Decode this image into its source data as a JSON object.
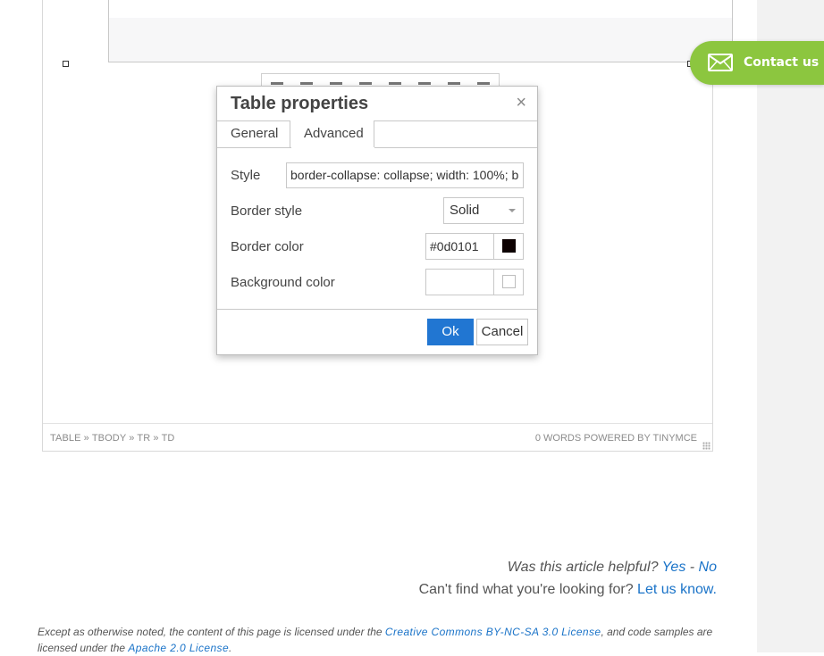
{
  "dialog": {
    "title": "Table properties",
    "close_glyph": "×",
    "tabs": [
      {
        "label": "General"
      },
      {
        "label": "Advanced"
      }
    ],
    "fields": {
      "style_label": "Style",
      "style_value": "border-collapse: collapse; width: 100%; b",
      "border_style_label": "Border style",
      "border_style_value": "Solid",
      "border_color_label": "Border color",
      "border_color_value": "#0d0101",
      "background_color_label": "Background color",
      "background_color_value": ""
    },
    "buttons": {
      "ok": "Ok",
      "cancel": "Cancel"
    }
  },
  "statusbar": {
    "path": "TABLE » TBODY » TR » TD",
    "word_count": "0 WORDS POWERED BY TINYMCE"
  },
  "contact": {
    "label": "Contact us",
    "icon": "envelope-icon"
  },
  "feedback": {
    "question": "Was this article helpful?",
    "yes": "Yes",
    "separator": "-",
    "no": "No",
    "cant_find": "Can't find what you're looking for?",
    "let_us_know": "Let us know."
  },
  "license": {
    "part1": "Except as otherwise noted, the content of this page is licensed under the ",
    "cc_link": "Creative Commons BY-NC-SA 3.0 License",
    "part2": ", and code samples are licensed under the ",
    "apache_link": "Apache 2.0 License",
    "part3": "."
  },
  "colors": {
    "accent": "#2176d2",
    "contact_green": "#8cc63f",
    "link": "#1a73c8"
  }
}
